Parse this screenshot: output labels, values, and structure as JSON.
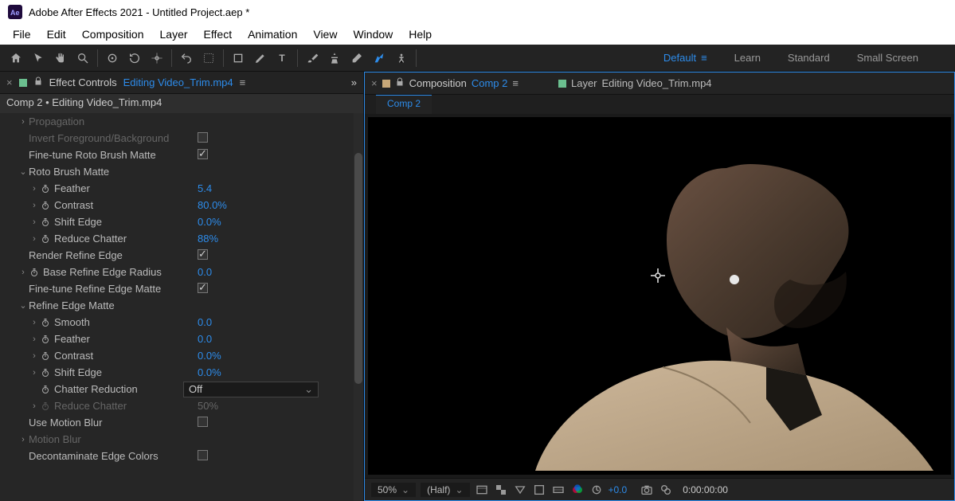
{
  "app": {
    "title": "Adobe After Effects 2021 - Untitled Project.aep *"
  },
  "menubar": [
    "File",
    "Edit",
    "Composition",
    "Layer",
    "Effect",
    "Animation",
    "View",
    "Window",
    "Help"
  ],
  "workspaces": {
    "items": [
      "Default",
      "Learn",
      "Standard",
      "Small Screen"
    ],
    "active": "Default"
  },
  "effect_panel": {
    "tab_prefix": "Effect Controls",
    "tab_file": "Editing Video_Trim.mp4",
    "sublabel": "Comp 2 • Editing Video_Trim.mp4",
    "rows": {
      "propagation": "Propagation",
      "invert": "Invert Foreground/Background",
      "finetune_roto": "Fine-tune Roto Brush Matte",
      "roto_matte": "Roto Brush Matte",
      "feather": "Feather",
      "feather_v": "5.4",
      "contrast": "Contrast",
      "contrast_v": "80.0%",
      "shift": "Shift Edge",
      "shift_v": "0.0%",
      "reduce": "Reduce Chatter",
      "reduce_v": "88%",
      "render_refine": "Render Refine Edge",
      "base_radius": "Base Refine Edge Radius",
      "base_radius_v": "0.0",
      "finetune_refine": "Fine-tune Refine Edge Matte",
      "refine_matte": "Refine Edge Matte",
      "smooth": "Smooth",
      "smooth_v": "0.0",
      "feather2": "Feather",
      "feather2_v": "0.0",
      "contrast2": "Contrast",
      "contrast2_v": "0.0%",
      "shift2": "Shift Edge",
      "shift2_v": "0.0%",
      "chatter_red": "Chatter Reduction",
      "chatter_red_v": "Off",
      "reduce2": "Reduce Chatter",
      "reduce2_v": "50%",
      "motion_blur": "Use Motion Blur",
      "motion_blur_group": "Motion Blur",
      "decon": "Decontaminate Edge Colors"
    }
  },
  "comp_panel": {
    "tab_prefix": "Composition",
    "tab_name": "Comp 2",
    "layer_prefix": "Layer",
    "layer_name": "Editing Video_Trim.mp4",
    "subtab": "Comp 2"
  },
  "footer": {
    "zoom": "50%",
    "res": "(Half)",
    "exposure": "+0.0",
    "timecode": "0:00:00:00"
  }
}
